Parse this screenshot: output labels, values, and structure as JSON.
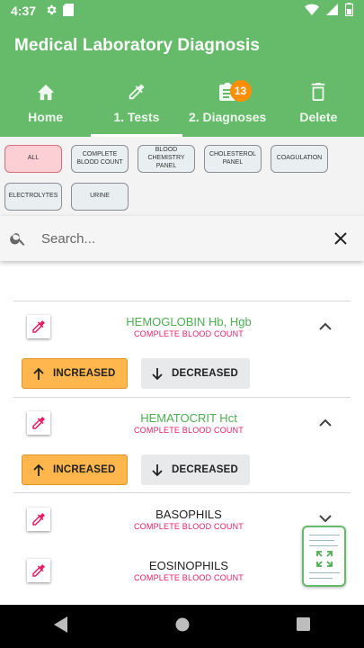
{
  "status_bar": {
    "time": "4:37"
  },
  "app": {
    "title": "Medical Laboratory Diagnosis",
    "tabs": [
      {
        "label": "Home",
        "icon": "home-icon"
      },
      {
        "label": "1. Tests",
        "icon": "pipette-icon",
        "active": true
      },
      {
        "label": "2. Diagnoses",
        "icon": "clipboard-icon",
        "badge": "13"
      },
      {
        "label": "Delete",
        "icon": "trash-icon"
      }
    ]
  },
  "filters": [
    {
      "label": "ALL",
      "active": true
    },
    {
      "label": "COMPLETE BLOOD COUNT"
    },
    {
      "label": "BLOOD CHEMISTRY PANEL"
    },
    {
      "label": "CHOLESTEROL PANEL"
    },
    {
      "label": "COAGULATION"
    },
    {
      "label": "ELECTROLYTES"
    },
    {
      "label": "URINE"
    }
  ],
  "search": {
    "placeholder": "Search..."
  },
  "tests": [
    {
      "name": "HEMOGLOBIN Hb, Hgb",
      "category": "COMPLETE BLOOD COUNT",
      "expanded": true,
      "increased": "INCREASED",
      "decreased": "DECREASED"
    },
    {
      "name": "HEMATOCRIT  Hct",
      "category": "COMPLETE BLOOD COUNT",
      "expanded": true,
      "increased": "INCREASED",
      "decreased": "DECREASED"
    },
    {
      "name": "BASOPHILS",
      "category": "COMPLETE BLOOD COUNT",
      "expanded": false
    },
    {
      "name": "EOSINOPHILS",
      "category": "COMPLETE BLOOD COUNT",
      "expanded": false
    }
  ],
  "colors": {
    "primary": "#66bb6a",
    "accent_pink": "#e91e63",
    "increase": "#ffb74d",
    "badge": "#ff8f00"
  }
}
